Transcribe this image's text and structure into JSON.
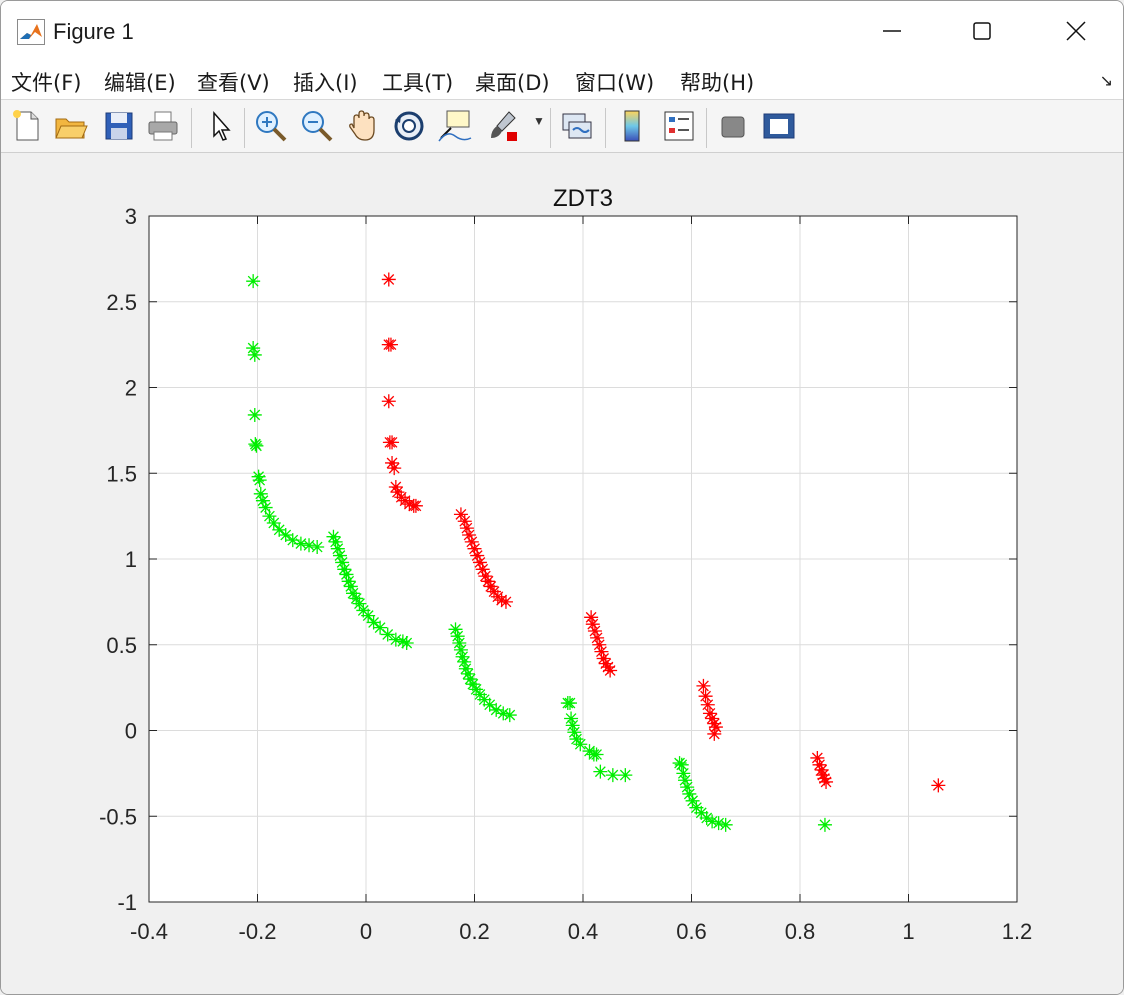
{
  "window": {
    "title": "Figure 1",
    "icon": "matlab-icon"
  },
  "window_controls": {
    "minimize": "minimize-icon",
    "maximize": "maximize-icon",
    "close": "close-icon"
  },
  "menu": {
    "items": [
      {
        "label": "文件(F)"
      },
      {
        "label": "编辑(E)"
      },
      {
        "label": "查看(V)"
      },
      {
        "label": "插入(I)"
      },
      {
        "label": "工具(T)"
      },
      {
        "label": "桌面(D)"
      },
      {
        "label": "窗口(W)"
      },
      {
        "label": "帮助(H)"
      }
    ],
    "dock_icon": "↘"
  },
  "toolbar": {
    "buttons": [
      "new-figure-icon",
      "open-file-icon",
      "save-icon",
      "print-icon",
      "edit-plot-arrow-icon",
      "zoom-in-icon",
      "zoom-out-icon",
      "pan-hand-icon",
      "rotate-3d-icon",
      "data-cursor-icon",
      "brush-icon",
      "link-plot-icon",
      "colorbar-icon",
      "legend-icon",
      "hide-plot-tools-icon",
      "show-plot-tools-icon"
    ]
  },
  "chart_data": {
    "type": "scatter",
    "title": "ZDT3",
    "xlabel": "",
    "ylabel": "",
    "xlim": [
      -0.4,
      1.2
    ],
    "ylim": [
      -1,
      3
    ],
    "xticks": [
      "-0.4",
      "-0.2",
      "0",
      "0.2",
      "0.4",
      "0.6",
      "0.8",
      "1",
      "1.2"
    ],
    "yticks": [
      "-1",
      "-0.5",
      "0",
      "0.5",
      "1",
      "1.5",
      "2",
      "2.5",
      "3"
    ],
    "grid": true,
    "marker": "asterisk",
    "colors": {
      "red": "#ff0000",
      "green": "#00ee00",
      "axes": "#262626",
      "grid": "#dcdcdc"
    },
    "series": [
      {
        "color": "#ff0000",
        "points": [
          [
            0.042,
            2.63
          ],
          [
            0.042,
            2.25
          ],
          [
            0.046,
            2.25
          ],
          [
            0.042,
            1.92
          ],
          [
            0.044,
            1.68
          ],
          [
            0.048,
            1.68
          ],
          [
            0.048,
            1.56
          ],
          [
            0.052,
            1.53
          ],
          [
            0.055,
            1.42
          ],
          [
            0.058,
            1.39
          ],
          [
            0.065,
            1.36
          ],
          [
            0.072,
            1.34
          ],
          [
            0.08,
            1.32
          ],
          [
            0.088,
            1.31
          ],
          [
            0.092,
            1.31
          ],
          [
            0.175,
            1.26
          ],
          [
            0.182,
            1.22
          ],
          [
            0.186,
            1.18
          ],
          [
            0.19,
            1.14
          ],
          [
            0.195,
            1.1
          ],
          [
            0.2,
            1.06
          ],
          [
            0.205,
            1.02
          ],
          [
            0.21,
            0.98
          ],
          [
            0.215,
            0.94
          ],
          [
            0.22,
            0.9
          ],
          [
            0.225,
            0.87
          ],
          [
            0.23,
            0.84
          ],
          [
            0.236,
            0.81
          ],
          [
            0.243,
            0.78
          ],
          [
            0.25,
            0.76
          ],
          [
            0.258,
            0.75
          ],
          [
            0.415,
            0.66
          ],
          [
            0.418,
            0.62
          ],
          [
            0.422,
            0.58
          ],
          [
            0.426,
            0.54
          ],
          [
            0.43,
            0.5
          ],
          [
            0.434,
            0.46
          ],
          [
            0.438,
            0.42
          ],
          [
            0.442,
            0.39
          ],
          [
            0.446,
            0.37
          ],
          [
            0.45,
            0.35
          ],
          [
            0.622,
            0.26
          ],
          [
            0.626,
            0.2
          ],
          [
            0.63,
            0.15
          ],
          [
            0.634,
            0.1
          ],
          [
            0.638,
            0.07
          ],
          [
            0.642,
            0.04
          ],
          [
            0.645,
            0.02
          ],
          [
            0.642,
            -0.02
          ],
          [
            0.832,
            -0.16
          ],
          [
            0.836,
            -0.2
          ],
          [
            0.84,
            -0.23
          ],
          [
            0.842,
            -0.26
          ],
          [
            0.845,
            -0.28
          ],
          [
            0.848,
            -0.3
          ],
          [
            1.055,
            -0.32
          ]
        ]
      },
      {
        "color": "#00ee00",
        "points": [
          [
            -0.208,
            2.62
          ],
          [
            -0.208,
            2.23
          ],
          [
            -0.205,
            2.19
          ],
          [
            -0.205,
            1.84
          ],
          [
            -0.204,
            1.67
          ],
          [
            -0.202,
            1.66
          ],
          [
            -0.198,
            1.48
          ],
          [
            -0.196,
            1.46
          ],
          [
            -0.194,
            1.38
          ],
          [
            -0.19,
            1.34
          ],
          [
            -0.185,
            1.3
          ],
          [
            -0.178,
            1.25
          ],
          [
            -0.17,
            1.21
          ],
          [
            -0.16,
            1.17
          ],
          [
            -0.148,
            1.14
          ],
          [
            -0.135,
            1.11
          ],
          [
            -0.12,
            1.09
          ],
          [
            -0.105,
            1.08
          ],
          [
            -0.09,
            1.07
          ],
          [
            -0.06,
            1.13
          ],
          [
            -0.056,
            1.1
          ],
          [
            -0.052,
            1.06
          ],
          [
            -0.048,
            1.02
          ],
          [
            -0.044,
            0.98
          ],
          [
            -0.04,
            0.94
          ],
          [
            -0.036,
            0.91
          ],
          [
            -0.032,
            0.87
          ],
          [
            -0.028,
            0.84
          ],
          [
            -0.024,
            0.8
          ],
          [
            -0.018,
            0.77
          ],
          [
            -0.012,
            0.74
          ],
          [
            -0.005,
            0.7
          ],
          [
            0.004,
            0.67
          ],
          [
            0.014,
            0.63
          ],
          [
            0.026,
            0.6
          ],
          [
            0.04,
            0.56
          ],
          [
            0.055,
            0.53
          ],
          [
            0.068,
            0.52
          ],
          [
            0.075,
            0.51
          ],
          [
            0.165,
            0.59
          ],
          [
            0.169,
            0.55
          ],
          [
            0.172,
            0.51
          ],
          [
            0.175,
            0.47
          ],
          [
            0.178,
            0.43
          ],
          [
            0.181,
            0.4
          ],
          [
            0.184,
            0.36
          ],
          [
            0.188,
            0.33
          ],
          [
            0.192,
            0.3
          ],
          [
            0.197,
            0.27
          ],
          [
            0.203,
            0.24
          ],
          [
            0.21,
            0.21
          ],
          [
            0.218,
            0.18
          ],
          [
            0.228,
            0.15
          ],
          [
            0.24,
            0.12
          ],
          [
            0.253,
            0.1
          ],
          [
            0.265,
            0.09
          ],
          [
            0.372,
            0.16
          ],
          [
            0.376,
            0.16
          ],
          [
            0.378,
            0.07
          ],
          [
            0.381,
            0.03
          ],
          [
            0.384,
            -0.01
          ],
          [
            0.388,
            -0.05
          ],
          [
            0.395,
            -0.08
          ],
          [
            0.412,
            -0.12
          ],
          [
            0.42,
            -0.14
          ],
          [
            0.425,
            -0.14
          ],
          [
            0.432,
            -0.24
          ],
          [
            0.455,
            -0.26
          ],
          [
            0.478,
            -0.26
          ],
          [
            0.578,
            -0.19
          ],
          [
            0.582,
            -0.2
          ],
          [
            0.585,
            -0.25
          ],
          [
            0.588,
            -0.29
          ],
          [
            0.592,
            -0.33
          ],
          [
            0.596,
            -0.37
          ],
          [
            0.602,
            -0.41
          ],
          [
            0.609,
            -0.45
          ],
          [
            0.618,
            -0.48
          ],
          [
            0.628,
            -0.51
          ],
          [
            0.638,
            -0.53
          ],
          [
            0.65,
            -0.54
          ],
          [
            0.663,
            -0.55
          ],
          [
            0.846,
            -0.55
          ]
        ]
      }
    ]
  }
}
